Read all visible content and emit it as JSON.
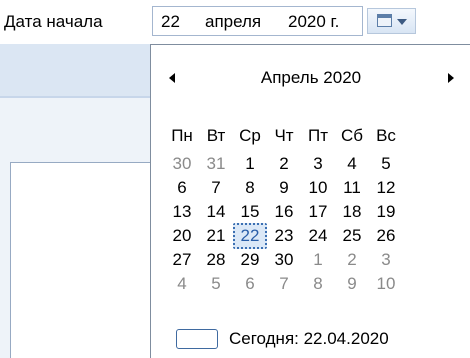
{
  "field": {
    "label": "Дата начала",
    "day": "22",
    "month": "апреля",
    "year": "2020 г."
  },
  "calendar": {
    "month_title": "Апрель 2020",
    "weekdays": [
      "Пн",
      "Вт",
      "Ср",
      "Чт",
      "Пт",
      "Сб",
      "Вс"
    ],
    "weeks": [
      [
        {
          "d": "30",
          "m": true
        },
        {
          "d": "31",
          "m": true
        },
        {
          "d": "1"
        },
        {
          "d": "2"
        },
        {
          "d": "3"
        },
        {
          "d": "4"
        },
        {
          "d": "5"
        }
      ],
      [
        {
          "d": "6"
        },
        {
          "d": "7"
        },
        {
          "d": "8"
        },
        {
          "d": "9"
        },
        {
          "d": "10"
        },
        {
          "d": "11"
        },
        {
          "d": "12"
        }
      ],
      [
        {
          "d": "13"
        },
        {
          "d": "14"
        },
        {
          "d": "15"
        },
        {
          "d": "16"
        },
        {
          "d": "17"
        },
        {
          "d": "18"
        },
        {
          "d": "19"
        }
      ],
      [
        {
          "d": "20"
        },
        {
          "d": "21"
        },
        {
          "d": "22",
          "t": true
        },
        {
          "d": "23"
        },
        {
          "d": "24"
        },
        {
          "d": "25"
        },
        {
          "d": "26"
        }
      ],
      [
        {
          "d": "27"
        },
        {
          "d": "28"
        },
        {
          "d": "29"
        },
        {
          "d": "30"
        },
        {
          "d": "1",
          "m": true
        },
        {
          "d": "2",
          "m": true
        },
        {
          "d": "3",
          "m": true
        }
      ],
      [
        {
          "d": "4",
          "m": true
        },
        {
          "d": "5",
          "m": true
        },
        {
          "d": "6",
          "m": true
        },
        {
          "d": "7",
          "m": true
        },
        {
          "d": "8",
          "m": true
        },
        {
          "d": "9",
          "m": true
        },
        {
          "d": "10",
          "m": true
        }
      ]
    ],
    "today_label": "Сегодня: 22.04.2020"
  },
  "icons": {
    "dropdown": "calendar-icon",
    "prev": "chevron-left-icon",
    "next": "chevron-right-icon"
  },
  "colors": {
    "selected_day": "#2a5ea8",
    "muted_day": "#8a8a8a"
  }
}
